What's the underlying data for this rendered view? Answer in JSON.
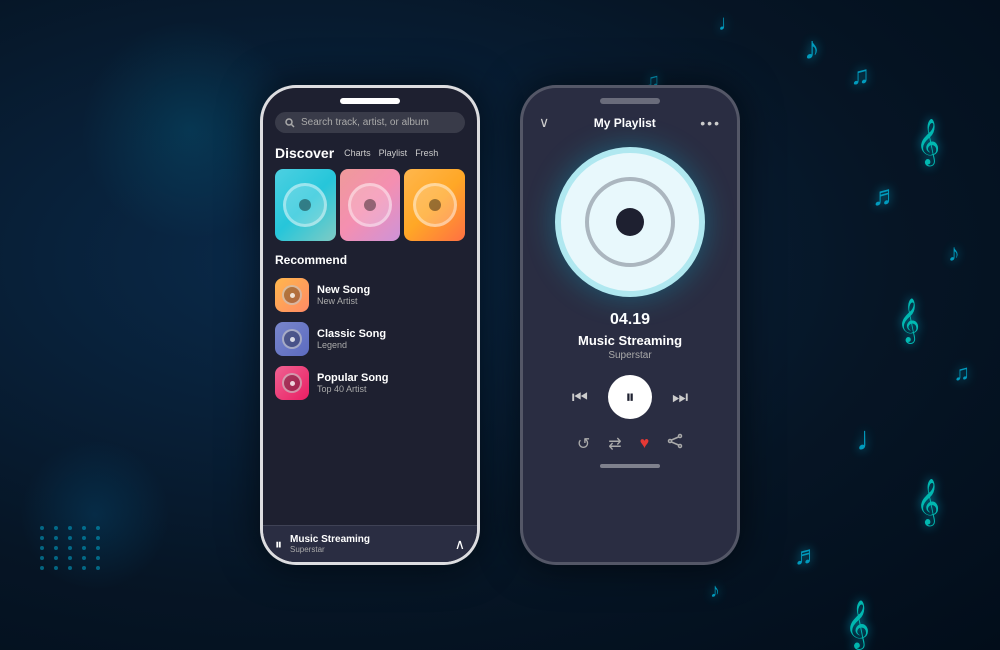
{
  "background": {
    "colors": [
      "#061525",
      "#020d1a"
    ]
  },
  "phone1": {
    "search": {
      "placeholder": "Search track, artist, or album"
    },
    "discover": {
      "title": "Discover",
      "nav_items": [
        "Charts",
        "Playlist",
        "Fresh"
      ]
    },
    "albums": [
      {
        "id": "album-1",
        "gradient": "teal"
      },
      {
        "id": "album-2",
        "gradient": "pink"
      },
      {
        "id": "album-3",
        "gradient": "orange"
      }
    ],
    "recommend": {
      "title": "Recommend",
      "songs": [
        {
          "name": "New Song",
          "artist": "New Artist",
          "thumb": "warm"
        },
        {
          "name": "Classic Song",
          "artist": "Legend",
          "thumb": "purple"
        },
        {
          "name": "Popular Song",
          "artist": "Top 40 Artist",
          "thumb": "pink"
        }
      ]
    },
    "mini_player": {
      "title": "Music Streaming",
      "artist": "Superstar"
    }
  },
  "phone2": {
    "header": {
      "title": "My Playlist",
      "dots": "•••"
    },
    "player": {
      "time": "04.19",
      "song_name": "Music Streaming",
      "artist": "Superstar"
    },
    "controls": {
      "prev": "⏮",
      "pause": "⏸",
      "next": "⏭"
    },
    "actions": {
      "repeat": "↺",
      "shuffle": "⇄",
      "heart": "♥",
      "share": "⇧"
    }
  },
  "music_notes": [
    "♩",
    "♪",
    "♫",
    "♬",
    "𝄞",
    "♩",
    "♪",
    "♫",
    "♬",
    "𝄞",
    "♩",
    "♪",
    "♫"
  ]
}
